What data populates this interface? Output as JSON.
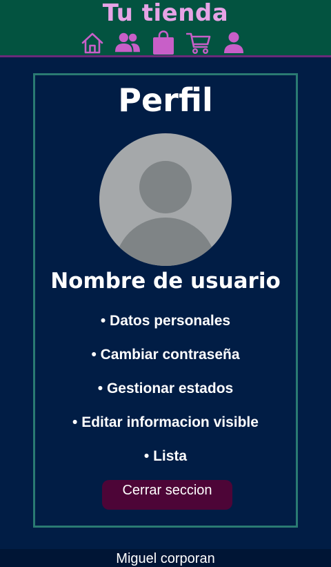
{
  "header": {
    "brand": "Tu tienda",
    "nav_icons": [
      "home-icon",
      "users-icon",
      "shopping-bag-icon",
      "cart-icon",
      "user-icon"
    ],
    "colors": {
      "background": "#035340",
      "brand_text": "#e7a3e6",
      "icon": "#c85fc8",
      "border": "#6b2a7a"
    }
  },
  "profile": {
    "title": "Perfil",
    "username": "Nombre de usuario",
    "menu": [
      "• Datos personales",
      "• Cambiar contraseña",
      "• Gestionar estados",
      "• Editar informacion visible",
      "• Lista"
    ],
    "logout_label": "Cerrar seccion"
  },
  "footer": {
    "text": "Miguel corporan"
  },
  "colors": {
    "page_background": "#011d45",
    "panel_border": "#2a7a72",
    "logout_button": "#4d0537",
    "avatar_background": "#a5a8aa",
    "avatar_silhouette": "#7f8486"
  }
}
